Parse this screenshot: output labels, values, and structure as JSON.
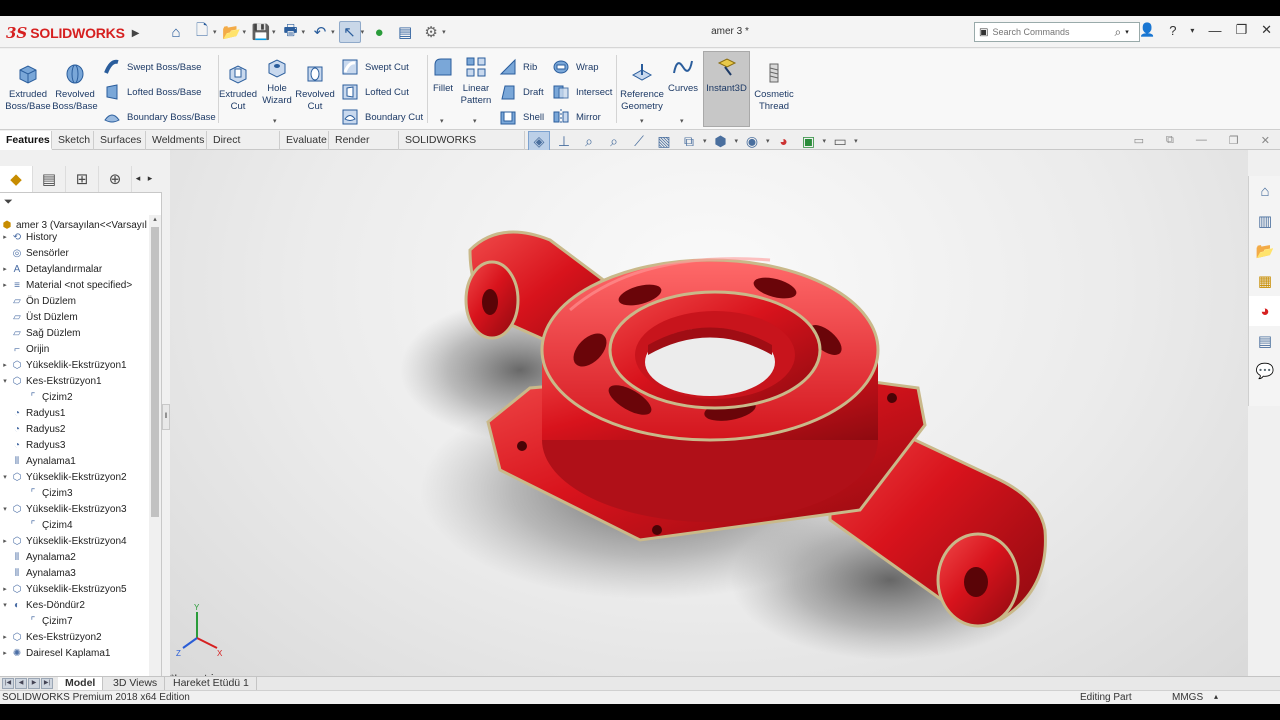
{
  "app": {
    "brand": "SOLIDWORKS",
    "document_title": "amer 3 *",
    "search_placeholder": "Search Commands",
    "help_label": "?"
  },
  "ribbon": {
    "large": [
      {
        "id": "extruded-boss",
        "label1": "Extruded",
        "label2": "Boss/Base"
      },
      {
        "id": "revolved-boss",
        "label1": "Revolved",
        "label2": "Boss/Base"
      },
      {
        "id": "extruded-cut",
        "label1": "Extruded",
        "label2": "Cut"
      },
      {
        "id": "hole-wizard",
        "label1": "Hole",
        "label2": "Wizard"
      },
      {
        "id": "revolved-cut",
        "label1": "Revolved",
        "label2": "Cut"
      },
      {
        "id": "fillet",
        "label1": "Fillet",
        "label2": ""
      },
      {
        "id": "linear-pattern",
        "label1": "Linear",
        "label2": "Pattern"
      },
      {
        "id": "reference-geometry",
        "label1": "Reference",
        "label2": "Geometry"
      },
      {
        "id": "curves",
        "label1": "Curves",
        "label2": ""
      },
      {
        "id": "instant3d",
        "label1": "Instant3D",
        "label2": ""
      },
      {
        "id": "cosmetic-thread",
        "label1": "Cosmetic",
        "label2": "Thread"
      }
    ],
    "small": [
      {
        "id": "swept-boss",
        "label": "Swept Boss/Base"
      },
      {
        "id": "lofted-boss",
        "label": "Lofted Boss/Base"
      },
      {
        "id": "boundary-boss",
        "label": "Boundary Boss/Base"
      },
      {
        "id": "swept-cut",
        "label": "Swept Cut"
      },
      {
        "id": "lofted-cut",
        "label": "Lofted Cut"
      },
      {
        "id": "boundary-cut",
        "label": "Boundary Cut"
      },
      {
        "id": "rib",
        "label": "Rib"
      },
      {
        "id": "draft",
        "label": "Draft"
      },
      {
        "id": "shell",
        "label": "Shell"
      },
      {
        "id": "wrap",
        "label": "Wrap"
      },
      {
        "id": "intersect",
        "label": "Intersect"
      },
      {
        "id": "mirror",
        "label": "Mirror"
      }
    ]
  },
  "tabs": [
    "Features",
    "Sketch",
    "Surfaces",
    "Weldments",
    "Direct Editing",
    "Evaluate",
    "Render Tools",
    "SOLIDWORKS Inspection"
  ],
  "tree": {
    "root": "amer 3  (Varsayılan<<Varsayıl",
    "nodes": [
      {
        "label": "History",
        "expand": true,
        "indent": 0,
        "icon": "history-icon"
      },
      {
        "label": "Sensörler",
        "expand": false,
        "indent": 0,
        "icon": "sensor-icon"
      },
      {
        "label": "Detaylandırmalar",
        "expand": true,
        "indent": 0,
        "icon": "annotation-icon"
      },
      {
        "label": "Material <not specified>",
        "expand": true,
        "indent": 0,
        "icon": "material-icon"
      },
      {
        "label": "Ön Düzlem",
        "expand": false,
        "indent": 0,
        "icon": "plane-icon"
      },
      {
        "label": "Üst Düzlem",
        "expand": false,
        "indent": 0,
        "icon": "plane-icon"
      },
      {
        "label": "Sağ Düzlem",
        "expand": false,
        "indent": 0,
        "icon": "plane-icon"
      },
      {
        "label": "Orijin",
        "expand": false,
        "indent": 0,
        "icon": "origin-icon"
      },
      {
        "label": "Yükseklik-Ekstrüzyon1",
        "expand": true,
        "indent": 0,
        "icon": "extrude-icon"
      },
      {
        "label": "Kes-Ekstrüzyon1",
        "expand": true,
        "indent": 0,
        "icon": "cut-icon",
        "open": true
      },
      {
        "label": "Çizim2",
        "expand": false,
        "indent": 1,
        "icon": "sketch-icon"
      },
      {
        "label": "Radyus1",
        "expand": false,
        "indent": 0,
        "icon": "fillet-icon"
      },
      {
        "label": "Radyus2",
        "expand": false,
        "indent": 0,
        "icon": "fillet-icon"
      },
      {
        "label": "Radyus3",
        "expand": false,
        "indent": 0,
        "icon": "fillet-icon"
      },
      {
        "label": "Aynalama1",
        "expand": false,
        "indent": 0,
        "icon": "mirror-icon"
      },
      {
        "label": "Yükseklik-Ekstrüzyon2",
        "expand": true,
        "indent": 0,
        "icon": "extrude-icon",
        "open": true
      },
      {
        "label": "Çizim3",
        "expand": false,
        "indent": 1,
        "icon": "sketch-icon"
      },
      {
        "label": "Yükseklik-Ekstrüzyon3",
        "expand": true,
        "indent": 0,
        "icon": "extrude-icon",
        "open": true
      },
      {
        "label": "Çizim4",
        "expand": false,
        "indent": 1,
        "icon": "sketch-icon"
      },
      {
        "label": "Yükseklik-Ekstrüzyon4",
        "expand": true,
        "indent": 0,
        "icon": "extrude-icon"
      },
      {
        "label": "Aynalama2",
        "expand": false,
        "indent": 0,
        "icon": "mirror-icon"
      },
      {
        "label": "Aynalama3",
        "expand": false,
        "indent": 0,
        "icon": "mirror-icon"
      },
      {
        "label": "Yükseklik-Ekstrüzyon5",
        "expand": true,
        "indent": 0,
        "icon": "extrude-icon"
      },
      {
        "label": "Kes-Döndür2",
        "expand": true,
        "indent": 0,
        "icon": "revolve-cut-icon",
        "open": true
      },
      {
        "label": "Çizim7",
        "expand": false,
        "indent": 1,
        "icon": "sketch-icon"
      },
      {
        "label": "Kes-Ekstrüzyon2",
        "expand": true,
        "indent": 0,
        "icon": "cut-icon"
      },
      {
        "label": "Dairesel Kaplama1",
        "expand": true,
        "indent": 0,
        "icon": "circular-pattern-icon"
      }
    ]
  },
  "viewport": {
    "view_name": "*Isometric",
    "part_color": "#d8131c",
    "edge_color": "#c9b98a",
    "triad": {
      "x": "X",
      "y": "Y",
      "z": "Z"
    }
  },
  "bottom_tabs": [
    "Model",
    "3D Views",
    "Hareket Etüdü 1"
  ],
  "status": {
    "edition": "SOLIDWORKS Premium 2018 x64 Edition",
    "mode": "Editing Part",
    "units": "MMGS"
  }
}
